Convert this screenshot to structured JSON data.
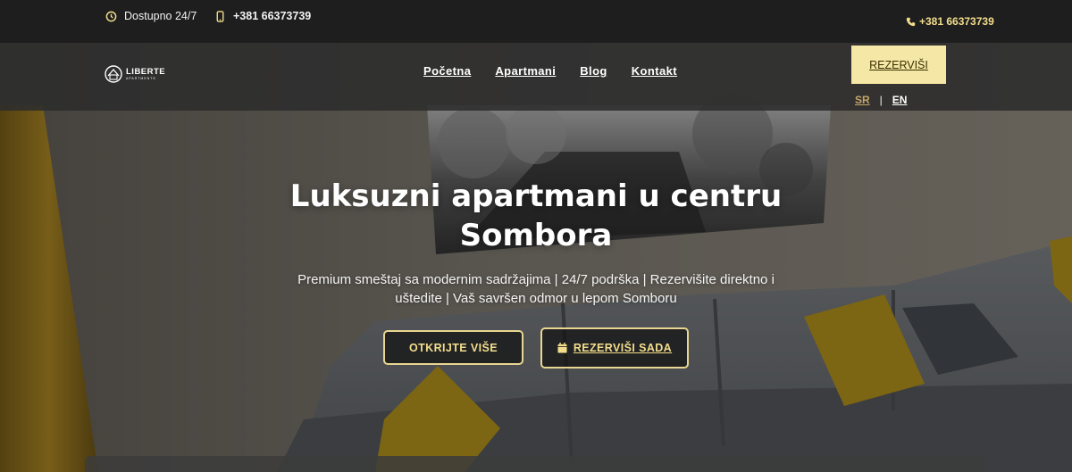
{
  "topbar": {
    "availability_text": "Dostupno 24/7",
    "phone_left": "+381 66373739",
    "phone_right": "+381 66373739"
  },
  "navbar": {
    "logo_text": "LIBERTE",
    "logo_subtext": "APARTMENTS",
    "links": [
      {
        "label": "Početna"
      },
      {
        "label": "Apartmani"
      },
      {
        "label": "Blog"
      },
      {
        "label": "Kontakt"
      }
    ],
    "reserve_label": "REZERVIŠI",
    "languages": {
      "sr": "SR",
      "separator": "|",
      "en": "EN"
    }
  },
  "hero": {
    "title_line1": "Luksuzni apartmani u centru",
    "title_line2": "Sombora",
    "subtitle_line1": "Premium smeštaj sa modernim sadržajima | 24/7 podrška | Rezervišite direktno i",
    "subtitle_line2": "uštedite | Vaš savršen odmor u lepom Somboru",
    "discover_label": "OTKRIJTE VIŠE",
    "book_label": "REZERVIŠI SADA"
  },
  "icons": {
    "clock": "clock-icon",
    "mobile": "mobile-phone-icon",
    "phone": "phone-icon",
    "calendar": "calendar-icon"
  },
  "colors": {
    "accent_gold": "#f3dd8c",
    "reserve_bg": "#f5e7a6",
    "topbar_bg": "#1e1e1e",
    "lang_active": "#c4a468"
  }
}
